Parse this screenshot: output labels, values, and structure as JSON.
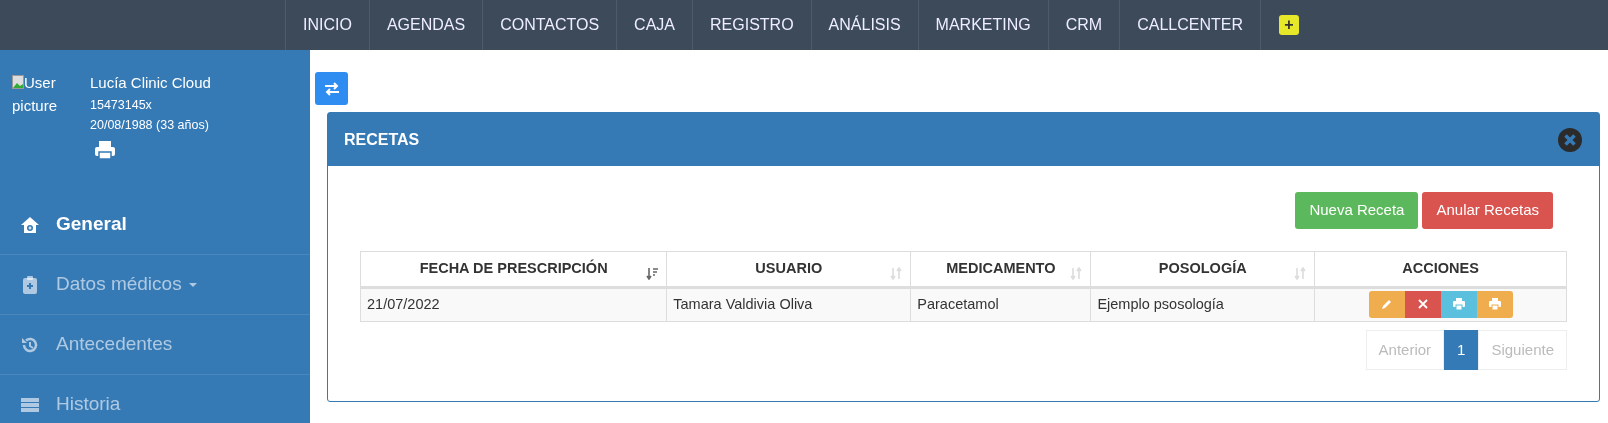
{
  "top_nav": {
    "items": [
      {
        "label": "INICIO"
      },
      {
        "label": "AGENDAS"
      },
      {
        "label": "CONTACTOS"
      },
      {
        "label": "CAJA"
      },
      {
        "label": "REGISTRO"
      },
      {
        "label": "ANÁLISIS"
      },
      {
        "label": "MARKETING"
      },
      {
        "label": "CRM"
      },
      {
        "label": "CALLCENTER"
      }
    ],
    "add_button": "+"
  },
  "patient": {
    "picture_alt": "User picture",
    "name": "Lucía Clinic Cloud",
    "id": "15473145x",
    "birth": "20/08/1988 (33 años)"
  },
  "sidebar": {
    "items": [
      {
        "label": "General",
        "selected": true,
        "dropdown": false
      },
      {
        "label": "Datos médicos",
        "selected": false,
        "dropdown": true
      },
      {
        "label": "Antecedentes",
        "selected": false,
        "dropdown": false
      },
      {
        "label": "Historia",
        "selected": false,
        "dropdown": false
      }
    ]
  },
  "panel": {
    "title": "RECETAS",
    "buttons": [
      {
        "label": "Nueva Receta",
        "color": "#5cb85c"
      },
      {
        "label": "Anular Recetas",
        "color": "#d9534f"
      }
    ],
    "table": {
      "columns": [
        {
          "label": "FECHA DE PRESCRIPCIÓN",
          "sortable": true,
          "sorted": true
        },
        {
          "label": "USUARIO",
          "sortable": true,
          "sorted": false
        },
        {
          "label": "MEDICAMENTO",
          "sortable": true,
          "sorted": false
        },
        {
          "label": "POSOLOGÍA",
          "sortable": true,
          "sorted": false
        },
        {
          "label": "ACCIONES",
          "sortable": false,
          "sorted": false
        }
      ],
      "rows": [
        {
          "cells": [
            "21/07/2022",
            "Tamara Valdivia Oliva",
            "Paracetamol",
            "Ejemplo psosología"
          ],
          "actions": [
            {
              "kind": "edit",
              "color": "#f0ad4e"
            },
            {
              "kind": "delete",
              "color": "#d9534f"
            },
            {
              "kind": "print",
              "color": "#5bc0de"
            },
            {
              "kind": "print",
              "color": "#f0ad4e"
            }
          ]
        }
      ]
    },
    "pagination": [
      {
        "label": "Anterior",
        "selected": false,
        "disabled": true
      },
      {
        "label": "1",
        "selected": true,
        "disabled": false
      },
      {
        "label": "Siguiente",
        "selected": false,
        "disabled": true
      }
    ]
  }
}
